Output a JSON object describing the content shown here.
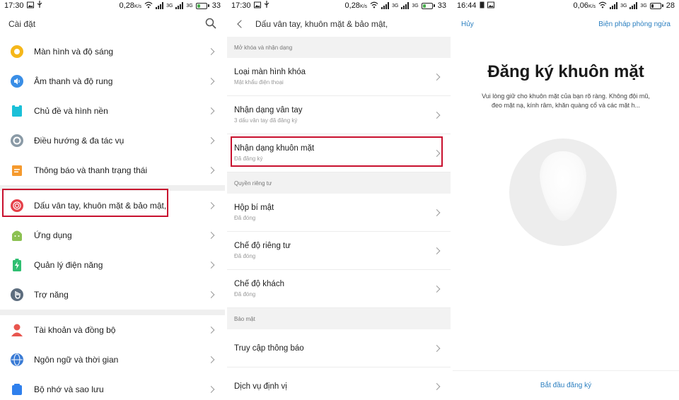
{
  "panel1": {
    "status": {
      "time": "17:30",
      "speed": "0,28",
      "speed_unit": "K/s",
      "net1": "3G",
      "net2": "3G",
      "battery": "33",
      "battery_level": 0.33
    },
    "title": "Cài đặt",
    "groups": [
      [
        {
          "label": "Màn hình và độ sáng",
          "icon": "sun-icon"
        },
        {
          "label": "Âm thanh và độ rung",
          "icon": "speaker-icon"
        },
        {
          "label": "Chủ đề và hình nền",
          "icon": "theme-icon"
        },
        {
          "label": "Điều hướng & đa tác vụ",
          "icon": "navigation-icon"
        },
        {
          "label": "Thông báo và thanh trạng thái",
          "icon": "notification-icon"
        }
      ],
      [
        {
          "label": "Dấu vân tay, khuôn mặt & bảo mật,",
          "icon": "fingerprint-icon"
        },
        {
          "label": "Ứng dụng",
          "icon": "android-icon"
        },
        {
          "label": "Quản lý điện năng",
          "icon": "battery-power-icon"
        },
        {
          "label": "Trợ năng",
          "icon": "hand-icon"
        }
      ],
      [
        {
          "label": "Tài khoản và đồng bộ",
          "icon": "person-icon"
        },
        {
          "label": "Ngôn ngữ và thời gian",
          "icon": "globe-icon"
        },
        {
          "label": "Bộ nhớ và sao lưu",
          "icon": "storage-icon"
        }
      ]
    ]
  },
  "panel2": {
    "status": {
      "time": "17:30",
      "speed": "0,28",
      "speed_unit": "K/s",
      "net1": "3G",
      "net2": "3G",
      "battery": "33",
      "battery_level": 0.33
    },
    "title": "Dấu vân tay, khuôn mặt & bảo mật,",
    "sections": [
      {
        "header": "Mở khóa và nhận dạng",
        "items": [
          {
            "title": "Loại màn hình khóa",
            "subtitle": "Mật khẩu điện thoại"
          },
          {
            "title": "Nhận dạng vân tay",
            "subtitle": "3 dấu vân tay đã đăng ký"
          },
          {
            "title": "Nhận dạng khuôn mặt",
            "subtitle": "Đã đăng ký"
          }
        ]
      },
      {
        "header": "Quyền riêng tư",
        "items": [
          {
            "title": "Hộp bí mật",
            "subtitle": "Đã đóng"
          },
          {
            "title": "Chế độ riêng tư",
            "subtitle": "Đã đóng"
          },
          {
            "title": "Chế độ khách",
            "subtitle": "Đã đóng"
          }
        ]
      },
      {
        "header": "Bảo mật",
        "items": [
          {
            "title": "Truy cập thông báo",
            "subtitle": ""
          },
          {
            "title": "Dịch vụ định vị",
            "subtitle": ""
          }
        ]
      }
    ]
  },
  "panel3": {
    "status": {
      "time": "16:44",
      "speed": "0,06",
      "speed_unit": "K/s",
      "net1": "3G",
      "net2": "3G",
      "battery": "28",
      "battery_level": 0.28
    },
    "cancel": "Hủy",
    "precaution": "Biện pháp phòng ngừa",
    "heading": "Đăng ký khuôn mặt",
    "description": "Vui lòng giữ cho khuôn mặt của bạn rõ ràng. Không đội mũ, đeo mặt nạ, kính râm, khăn quàng cổ và các mặt h...",
    "start": "Bắt đầu đăng ký"
  },
  "colors": {
    "highlight": "#c8102e",
    "link": "#2b7fc0",
    "battery_green": "#4caf50",
    "section_bg": "#efefef"
  }
}
